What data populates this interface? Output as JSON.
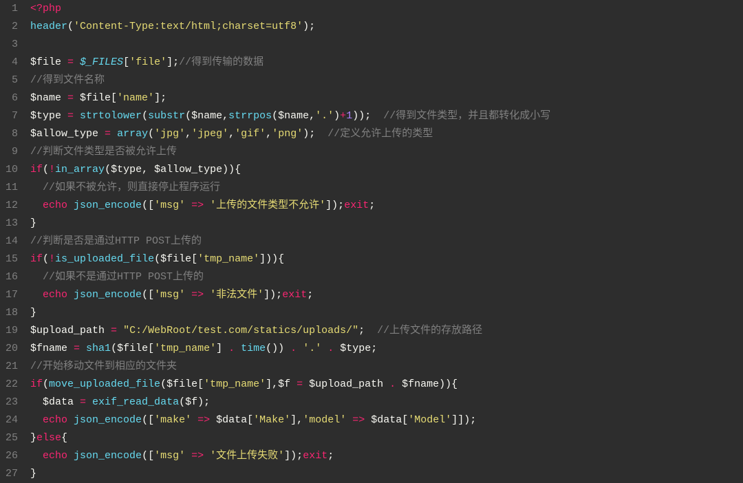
{
  "lineCount": 27,
  "lines": [
    [
      [
        "t-tag",
        "<?php"
      ]
    ],
    [
      [
        "t-func",
        "header"
      ],
      [
        "t-punc",
        "("
      ],
      [
        "t-str",
        "'Content-Type:text/html;charset=utf8'"
      ],
      [
        "t-punc",
        ");"
      ]
    ],
    [],
    [
      [
        "t-var",
        "$file "
      ],
      [
        "t-op",
        "="
      ],
      [
        "t-var",
        " "
      ],
      [
        "t-global",
        "$_FILES"
      ],
      [
        "t-punc",
        "["
      ],
      [
        "t-str",
        "'file'"
      ],
      [
        "t-punc",
        "];"
      ],
      [
        "t-cmt",
        "//得到传输的数据"
      ]
    ],
    [
      [
        "t-cmt",
        "//得到文件名称"
      ]
    ],
    [
      [
        "t-var",
        "$name "
      ],
      [
        "t-op",
        "="
      ],
      [
        "t-var",
        " $file["
      ],
      [
        "t-str",
        "'name'"
      ],
      [
        "t-punc",
        "];"
      ]
    ],
    [
      [
        "t-var",
        "$type "
      ],
      [
        "t-op",
        "="
      ],
      [
        "t-var",
        " "
      ],
      [
        "t-func",
        "strtolower"
      ],
      [
        "t-punc",
        "("
      ],
      [
        "t-func",
        "substr"
      ],
      [
        "t-punc",
        "($name,"
      ],
      [
        "t-func",
        "strrpos"
      ],
      [
        "t-punc",
        "($name,"
      ],
      [
        "t-str",
        "'.'"
      ],
      [
        "t-punc",
        ")"
      ],
      [
        "t-op",
        "+"
      ],
      [
        "t-num",
        "1"
      ],
      [
        "t-punc",
        "));  "
      ],
      [
        "t-cmt",
        "//得到文件类型，并且都转化成小写"
      ]
    ],
    [
      [
        "t-var",
        "$allow_type "
      ],
      [
        "t-op",
        "="
      ],
      [
        "t-var",
        " "
      ],
      [
        "t-func",
        "array"
      ],
      [
        "t-punc",
        "("
      ],
      [
        "t-str",
        "'jpg'"
      ],
      [
        "t-punc",
        ","
      ],
      [
        "t-str",
        "'jpeg'"
      ],
      [
        "t-punc",
        ","
      ],
      [
        "t-str",
        "'gif'"
      ],
      [
        "t-punc",
        ","
      ],
      [
        "t-str",
        "'png'"
      ],
      [
        "t-punc",
        ");  "
      ],
      [
        "t-cmt",
        "//定义允许上传的类型"
      ]
    ],
    [
      [
        "t-cmt",
        "//判断文件类型是否被允许上传"
      ]
    ],
    [
      [
        "t-kw",
        "if"
      ],
      [
        "t-punc",
        "("
      ],
      [
        "t-op",
        "!"
      ],
      [
        "t-func",
        "in_array"
      ],
      [
        "t-punc",
        "($type, $allow_type)){"
      ]
    ],
    [
      [
        "t-var",
        "  "
      ],
      [
        "t-cmt",
        "//如果不被允许，则直接停止程序运行"
      ]
    ],
    [
      [
        "t-var",
        "  "
      ],
      [
        "t-kw",
        "echo"
      ],
      [
        "t-var",
        " "
      ],
      [
        "t-func",
        "json_encode"
      ],
      [
        "t-punc",
        "(["
      ],
      [
        "t-str",
        "'msg'"
      ],
      [
        "t-var",
        " "
      ],
      [
        "t-op",
        "=>"
      ],
      [
        "t-var",
        " "
      ],
      [
        "t-str",
        "'上传的文件类型不允许'"
      ],
      [
        "t-punc",
        "]);"
      ],
      [
        "t-kw",
        "exit"
      ],
      [
        "t-punc",
        ";"
      ]
    ],
    [
      [
        "t-punc",
        "}"
      ]
    ],
    [
      [
        "t-cmt",
        "//判断是否是通过HTTP POST上传的"
      ]
    ],
    [
      [
        "t-kw",
        "if"
      ],
      [
        "t-punc",
        "("
      ],
      [
        "t-op",
        "!"
      ],
      [
        "t-func",
        "is_uploaded_file"
      ],
      [
        "t-punc",
        "($file["
      ],
      [
        "t-str",
        "'tmp_name'"
      ],
      [
        "t-punc",
        "])){"
      ]
    ],
    [
      [
        "t-var",
        "  "
      ],
      [
        "t-cmt",
        "//如果不是通过HTTP POST上传的"
      ]
    ],
    [
      [
        "t-var",
        "  "
      ],
      [
        "t-kw",
        "echo"
      ],
      [
        "t-var",
        " "
      ],
      [
        "t-func",
        "json_encode"
      ],
      [
        "t-punc",
        "(["
      ],
      [
        "t-str",
        "'msg'"
      ],
      [
        "t-var",
        " "
      ],
      [
        "t-op",
        "=>"
      ],
      [
        "t-var",
        " "
      ],
      [
        "t-str",
        "'非法文件'"
      ],
      [
        "t-punc",
        "]);"
      ],
      [
        "t-kw",
        "exit"
      ],
      [
        "t-punc",
        ";"
      ]
    ],
    [
      [
        "t-punc",
        "}"
      ]
    ],
    [
      [
        "t-var",
        "$upload_path "
      ],
      [
        "t-op",
        "="
      ],
      [
        "t-var",
        " "
      ],
      [
        "t-str",
        "\"C:/WebRoot/test.com/statics/uploads/\""
      ],
      [
        "t-punc",
        ";  "
      ],
      [
        "t-cmt",
        "//上传文件的存放路径"
      ]
    ],
    [
      [
        "t-var",
        "$fname "
      ],
      [
        "t-op",
        "="
      ],
      [
        "t-var",
        " "
      ],
      [
        "t-func",
        "sha1"
      ],
      [
        "t-punc",
        "($file["
      ],
      [
        "t-str",
        "'tmp_name'"
      ],
      [
        "t-punc",
        "] "
      ],
      [
        "t-op",
        "."
      ],
      [
        "t-var",
        " "
      ],
      [
        "t-func",
        "time"
      ],
      [
        "t-punc",
        "()) "
      ],
      [
        "t-op",
        "."
      ],
      [
        "t-var",
        " "
      ],
      [
        "t-str",
        "'.'"
      ],
      [
        "t-var",
        " "
      ],
      [
        "t-op",
        "."
      ],
      [
        "t-var",
        " $type;"
      ]
    ],
    [
      [
        "t-cmt",
        "//开始移动文件到相应的文件夹"
      ]
    ],
    [
      [
        "t-kw",
        "if"
      ],
      [
        "t-punc",
        "("
      ],
      [
        "t-func",
        "move_uploaded_file"
      ],
      [
        "t-punc",
        "($file["
      ],
      [
        "t-str",
        "'tmp_name'"
      ],
      [
        "t-punc",
        "],$f "
      ],
      [
        "t-op",
        "="
      ],
      [
        "t-var",
        " $upload_path "
      ],
      [
        "t-op",
        "."
      ],
      [
        "t-var",
        " $fname)){"
      ]
    ],
    [
      [
        "t-var",
        "  $data "
      ],
      [
        "t-op",
        "="
      ],
      [
        "t-var",
        " "
      ],
      [
        "t-func",
        "exif_read_data"
      ],
      [
        "t-punc",
        "($f);"
      ]
    ],
    [
      [
        "t-var",
        "  "
      ],
      [
        "t-kw",
        "echo"
      ],
      [
        "t-var",
        " "
      ],
      [
        "t-func",
        "json_encode"
      ],
      [
        "t-punc",
        "(["
      ],
      [
        "t-str",
        "'make'"
      ],
      [
        "t-var",
        " "
      ],
      [
        "t-op",
        "=>"
      ],
      [
        "t-var",
        " $data["
      ],
      [
        "t-str",
        "'Make'"
      ],
      [
        "t-punc",
        "],"
      ],
      [
        "t-str",
        "'model'"
      ],
      [
        "t-var",
        " "
      ],
      [
        "t-op",
        "=>"
      ],
      [
        "t-var",
        " $data["
      ],
      [
        "t-str",
        "'Model'"
      ],
      [
        "t-punc",
        "]]);"
      ]
    ],
    [
      [
        "t-punc",
        "}"
      ],
      [
        "t-kw",
        "else"
      ],
      [
        "t-punc",
        "{"
      ]
    ],
    [
      [
        "t-var",
        "  "
      ],
      [
        "t-kw",
        "echo"
      ],
      [
        "t-var",
        " "
      ],
      [
        "t-func",
        "json_encode"
      ],
      [
        "t-punc",
        "(["
      ],
      [
        "t-str",
        "'msg'"
      ],
      [
        "t-var",
        " "
      ],
      [
        "t-op",
        "=>"
      ],
      [
        "t-var",
        " "
      ],
      [
        "t-str",
        "'文件上传失败'"
      ],
      [
        "t-punc",
        "]);"
      ],
      [
        "t-kw",
        "exit"
      ],
      [
        "t-punc",
        ";"
      ]
    ],
    [
      [
        "t-punc",
        "}"
      ]
    ]
  ]
}
